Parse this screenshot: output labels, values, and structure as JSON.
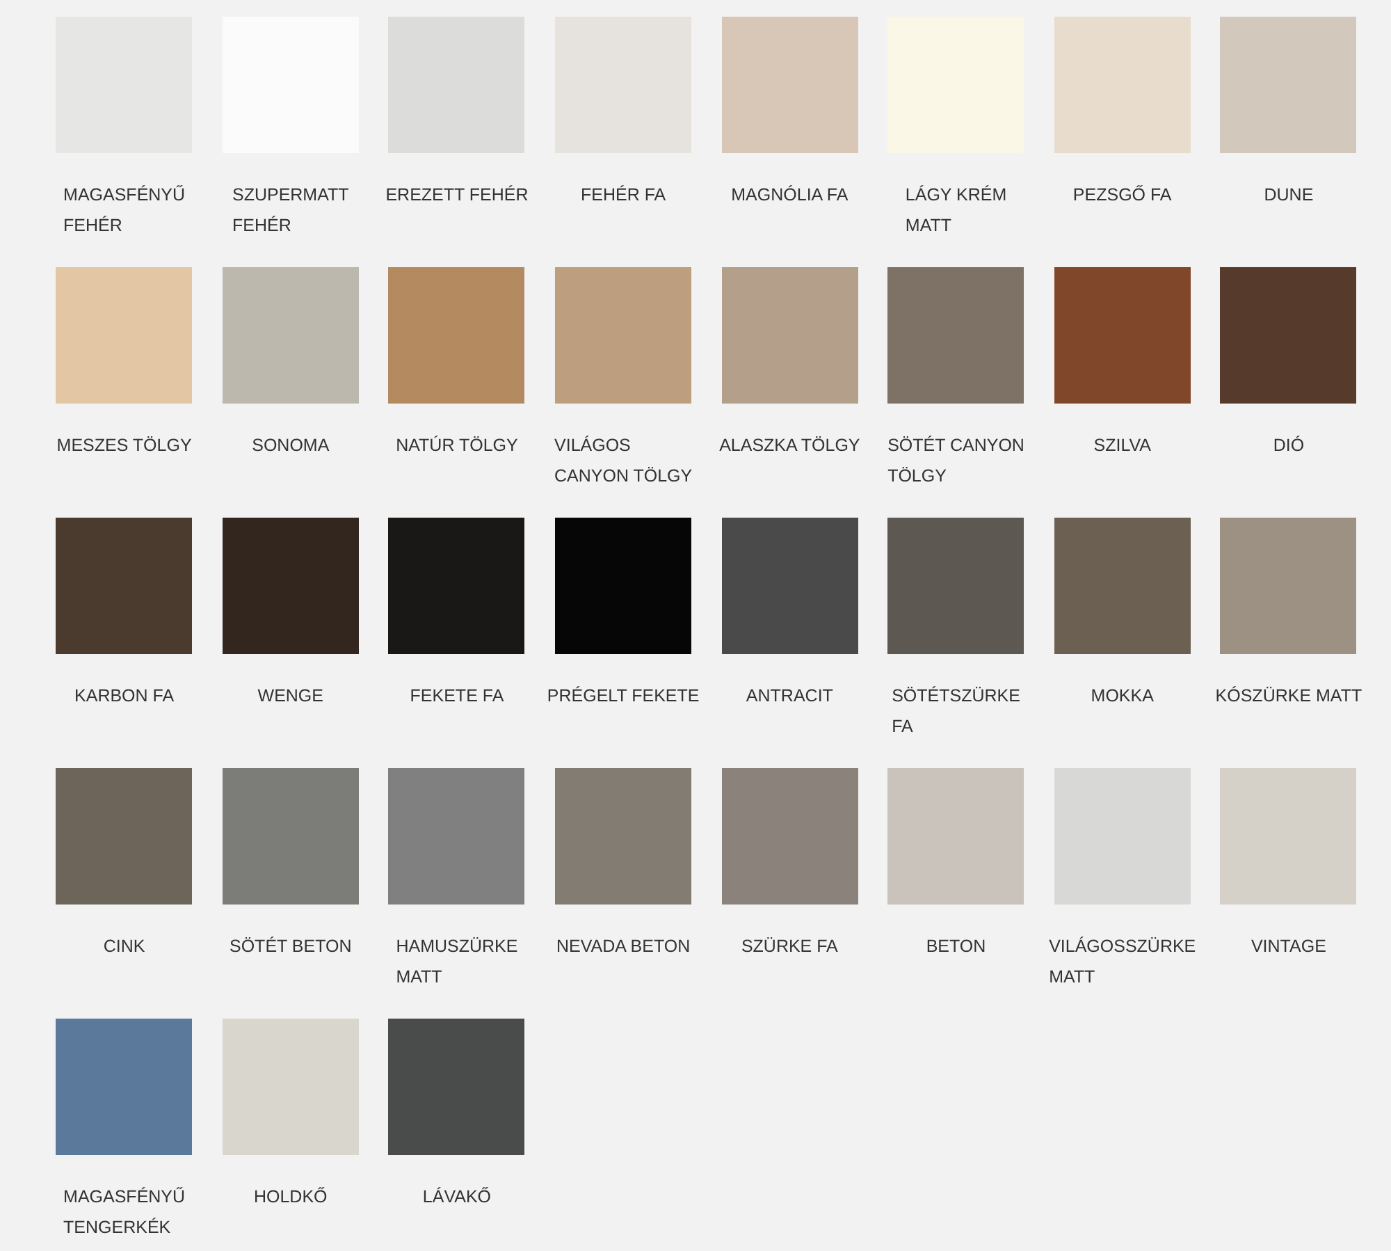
{
  "swatches": [
    {
      "label": "MAGASFÉNYŰ\nFEHÉR",
      "color": "#e6e7e4"
    },
    {
      "label": "SZUPERMATT\nFEHÉR",
      "color": "#fbfbfb"
    },
    {
      "label": "EREZETT FEHÉR",
      "color": "#dcdcda"
    },
    {
      "label": "FEHÉR FA",
      "color": "#e6e3de"
    },
    {
      "label": "MAGNÓLIA FA",
      "color": "#d8c6b6"
    },
    {
      "label": "LÁGY KRÉM\nMATT",
      "color": "#fbf7e6"
    },
    {
      "label": "PEZSGŐ FA",
      "color": "#e8dccd"
    },
    {
      "label": "DUNE",
      "color": "#d2c8bb"
    },
    {
      "label": "MESZES TÖLGY",
      "color": "#e3c7a5"
    },
    {
      "label": "SONOMA",
      "color": "#bdb8ae"
    },
    {
      "label": "NATÚR TÖLGY",
      "color": "#b48b61"
    },
    {
      "label": "VILÁGOS\nCANYON TÖLGY",
      "color": "#bd9f80"
    },
    {
      "label": "ALASZKA TÖLGY",
      "color": "#b4a08a"
    },
    {
      "label": "SÖTÉT CANYON\nTÖLGY",
      "color": "#7e7266"
    },
    {
      "label": "SZILVA",
      "color": "#80472a"
    },
    {
      "label": "DIÓ",
      "color": "#563b2c"
    },
    {
      "label": "KARBON FA",
      "color": "#4b3a2e"
    },
    {
      "label": "WENGE",
      "color": "#32261f"
    },
    {
      "label": "FEKETE FA",
      "color": "#1a1817"
    },
    {
      "label": "PRÉGELT FEKETE",
      "color": "#060606"
    },
    {
      "label": "ANTRACIT",
      "color": "#4a4a4a"
    },
    {
      "label": "SÖTÉTSZÜRKE\nFA",
      "color": "#5e5852"
    },
    {
      "label": "MOKKA",
      "color": "#6c6053"
    },
    {
      "label": "KÓSZÜRKE MATT",
      "color": "#9d9184"
    },
    {
      "label": "CINK",
      "color": "#6d6559"
    },
    {
      "label": "SÖTÉT BETON",
      "color": "#7c7d78"
    },
    {
      "label": "HAMUSZÜRKE\nMATT",
      "color": "#808080"
    },
    {
      "label": "NEVADA BETON",
      "color": "#827c73"
    },
    {
      "label": "SZÜRKE FA",
      "color": "#8b827b"
    },
    {
      "label": "BETON",
      "color": "#c9c3bb"
    },
    {
      "label": "VILÁGOSSZÜRKE\nMATT",
      "color": "#d8d8d6"
    },
    {
      "label": "VINTAGE",
      "color": "#d6d1c8"
    },
    {
      "label": "MAGASFÉNYŰ\nTENGERKÉK",
      "color": "#5b7a9b"
    },
    {
      "label": "HOLDKŐ",
      "color": "#d8d6cd"
    },
    {
      "label": "LÁVAKŐ",
      "color": "#4a4b4b"
    }
  ]
}
